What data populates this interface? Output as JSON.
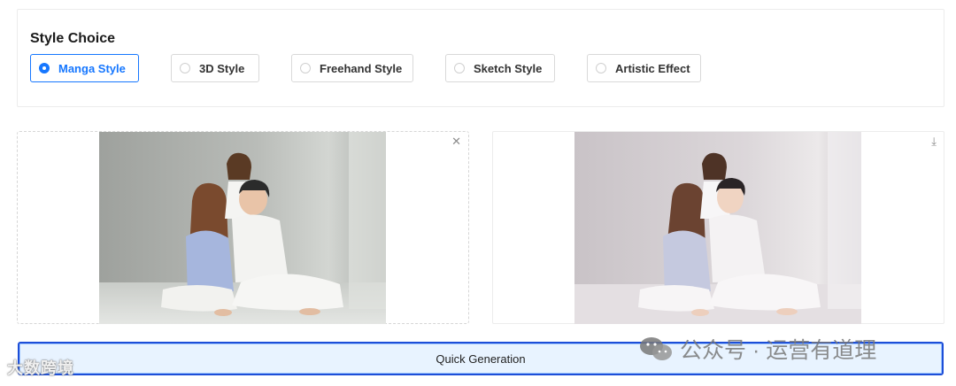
{
  "style_choice": {
    "title": "Style Choice",
    "options": [
      {
        "label": "Manga Style",
        "selected": true
      },
      {
        "label": "3D Style",
        "selected": false
      },
      {
        "label": "Freehand Style",
        "selected": false
      },
      {
        "label": "Sketch Style",
        "selected": false
      },
      {
        "label": "Artistic Effect",
        "selected": false
      }
    ]
  },
  "source_panel": {
    "close_icon": "close-icon"
  },
  "result_panel": {
    "download_icon": "download-icon"
  },
  "generate": {
    "label": "Quick Generation"
  },
  "watermarks": {
    "left_text": "大数跨境",
    "right_text": "公众号 · 运营有道理"
  },
  "colors": {
    "accent": "#1677ff",
    "button_border": "#1d4ed8",
    "button_bg": "#e8f3ff"
  }
}
